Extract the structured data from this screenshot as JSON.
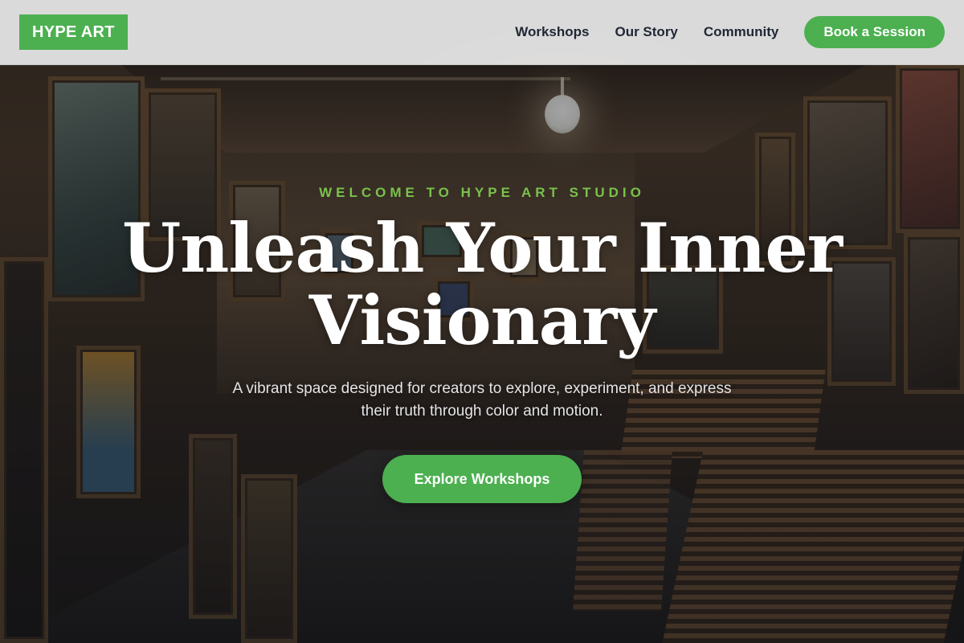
{
  "header": {
    "logo": "HYPE ART",
    "nav": [
      {
        "label": "Workshops"
      },
      {
        "label": "Our Story"
      },
      {
        "label": "Community"
      }
    ],
    "cta_label": "Book a Session"
  },
  "hero": {
    "eyebrow": "Welcome to Hype Art Studio",
    "title": "Unleash Your Inner Visionary",
    "subtitle": "A vibrant space designed for creators to explore, experiment, and express their truth through color and motion.",
    "button_label": "Explore Workshops"
  },
  "colors": {
    "accent_green": "#4cb050",
    "eyebrow_green": "#79c24a",
    "nav_text": "#1f2633",
    "header_bg": "#e8e8ea"
  }
}
